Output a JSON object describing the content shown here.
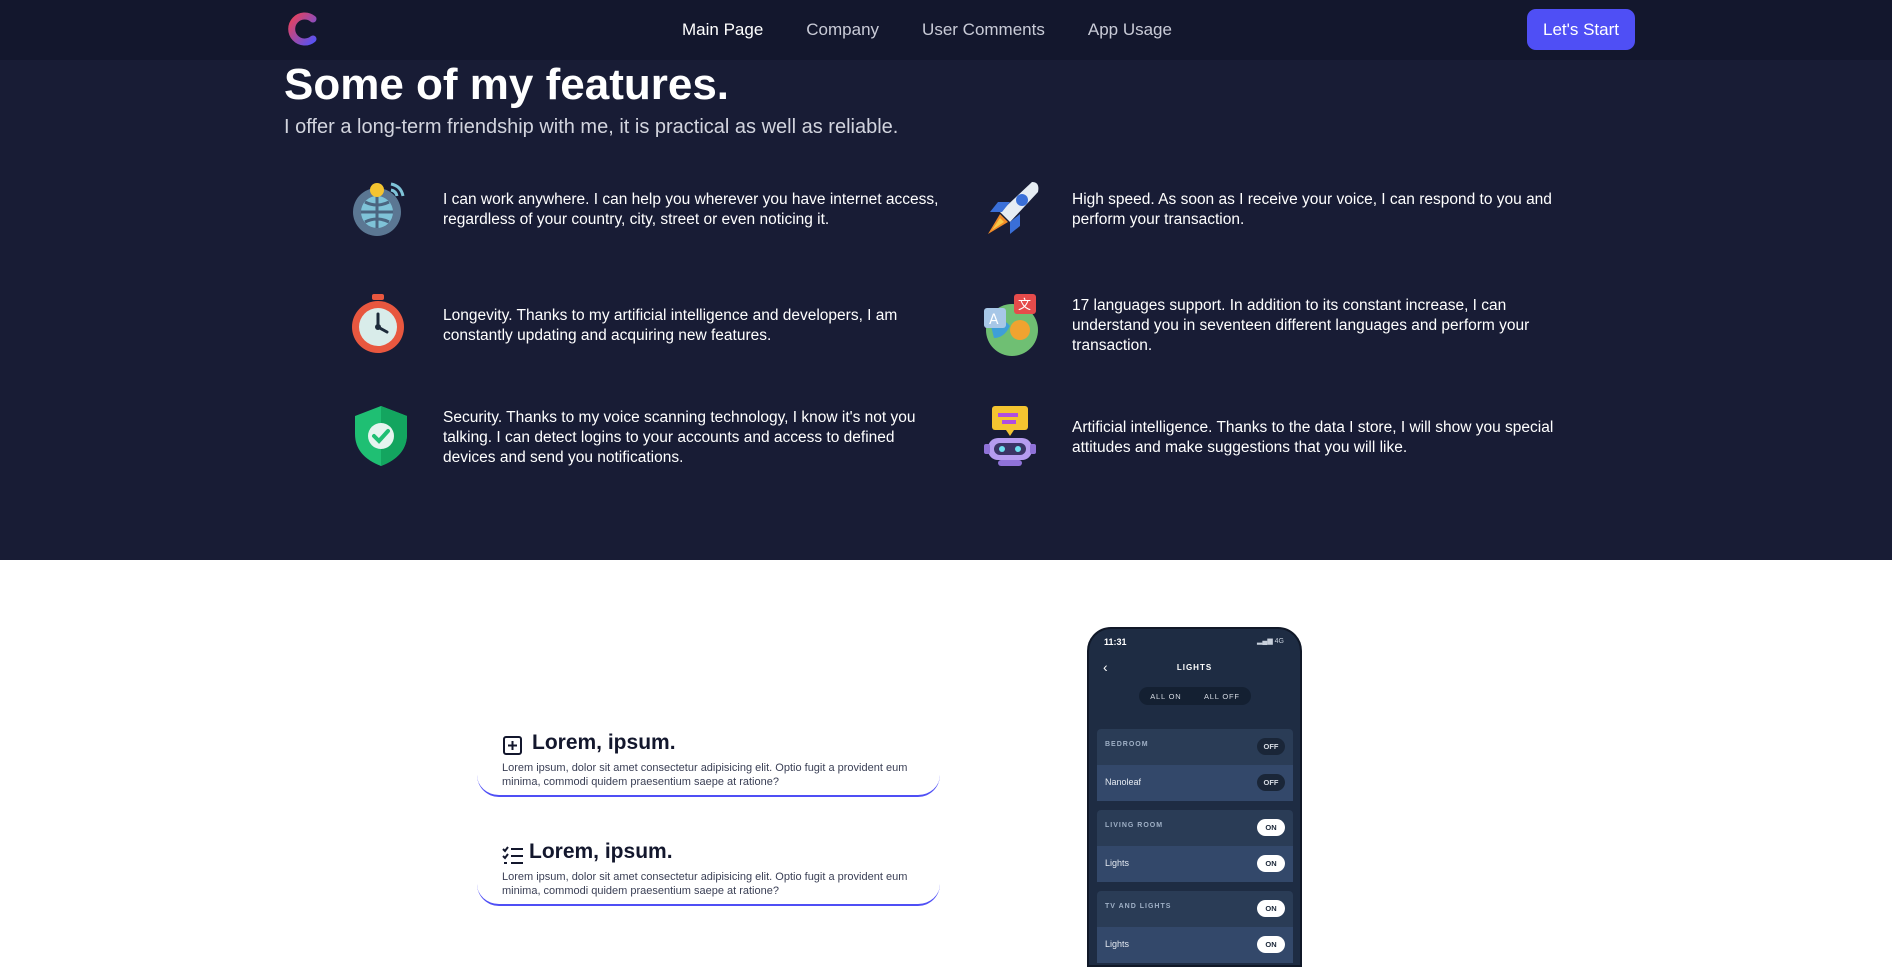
{
  "nav": {
    "links": [
      "Main Page",
      "Company",
      "User Comments",
      "App Usage"
    ],
    "cta": "Let's Start",
    "logo_icon": "brand-c-logo"
  },
  "hero": {
    "title": "Some of my features.",
    "subtitle": "I offer a long-term friendship with me, it is practical as well as reliable."
  },
  "features": [
    {
      "icon": "globe-icon",
      "text": "I can work anywhere. I can help you wherever you have internet access, regardless of your country, city, street or even noticing it."
    },
    {
      "icon": "rocket-icon",
      "text": "High speed. As soon as I receive your voice, I can respond to you and perform your transaction."
    },
    {
      "icon": "stopwatch-icon",
      "text": "Longevity. Thanks to my artificial intelligence and developers, I am constantly updating and acquiring new features."
    },
    {
      "icon": "languages-icon",
      "text": "17 languages support. In addition to its constant increase, I can understand you in seventeen different languages and perform your transaction."
    },
    {
      "icon": "shield-icon",
      "text": "Security. Thanks to my voice scanning technology, I know it's not you talking. I can detect logins to your accounts and access to defined devices and send you notifications."
    },
    {
      "icon": "robot-icon",
      "text": "Artificial intelligence. Thanks to the data I store, I will show you special attitudes and make suggestions that you will like."
    }
  ],
  "cards": [
    {
      "icon": "plus-square-icon",
      "title": "Lorem, ipsum.",
      "desc": "Lorem ipsum, dolor sit amet consectetur adipisicing elit. Optio fugit a provident eum minima, commodi quidem praesentium saepe at ratione?"
    },
    {
      "icon": "checklist-icon",
      "title": "Lorem, ipsum.",
      "desc": "Lorem ipsum, dolor sit amet consectetur adipisicing elit. Optio fugit a provident eum minima, commodi quidem praesentium saepe at ratione?"
    }
  ],
  "phone": {
    "time": "11:31",
    "signal": "4G",
    "title": "LIGHTS",
    "all_on": "ALL ON",
    "all_off": "ALL OFF",
    "groups": [
      {
        "name": "BEDROOM",
        "state": "OFF",
        "item": "Nanoleaf",
        "item_state": "OFF"
      },
      {
        "name": "LIVING ROOM",
        "state": "ON",
        "item": "Lights",
        "item_state": "ON"
      },
      {
        "name": "TV AND LIGHTS",
        "state": "ON",
        "item": "Lights",
        "item_state": "ON"
      }
    ]
  },
  "colors": {
    "dark_bg": "#181c35",
    "nav_bg": "#13172d",
    "accent": "#4f4ff5"
  }
}
